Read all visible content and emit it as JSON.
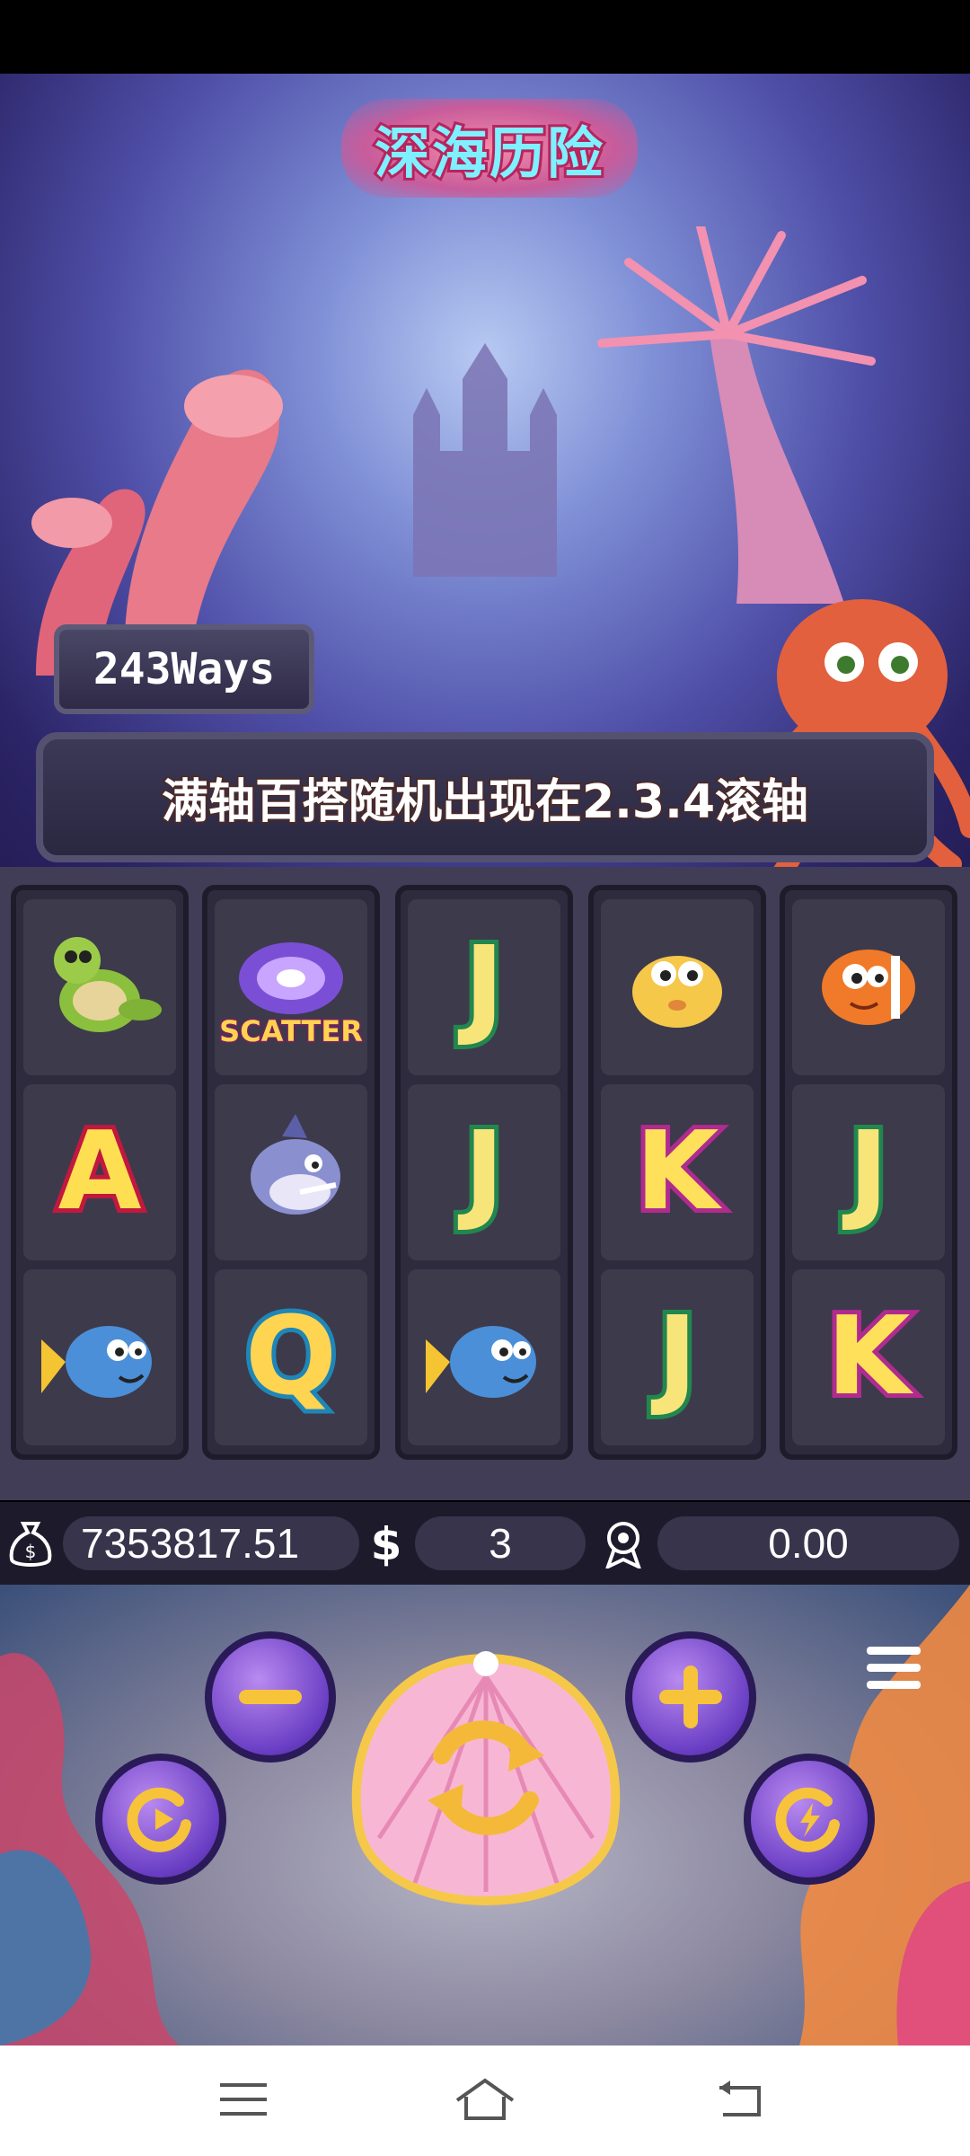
{
  "game": {
    "logo_title": "深海历险",
    "ways_label": "243Ways",
    "banner_text": "满轴百搭随机出现在2.3.4滚轴"
  },
  "reels": [
    [
      "turtle",
      "A",
      "fish"
    ],
    [
      "scatter",
      "shark",
      "Q"
    ],
    [
      "J",
      "J",
      "fish"
    ],
    [
      "pufferfish",
      "K",
      "J"
    ],
    [
      "clownfish",
      "J",
      "K"
    ]
  ],
  "symbols": {
    "scatter_label": "SCATTER",
    "A": "A",
    "K": "K",
    "Q": "Q",
    "J": "J"
  },
  "info_bar": {
    "balance_icon": "money-bag-icon",
    "balance": "7353817.51",
    "bet_icon": "dollar-icon",
    "bet": "3",
    "win_icon": "award-icon",
    "win": "0.00"
  },
  "controls": {
    "decrease_icon": "minus-icon",
    "increase_icon": "plus-icon",
    "spin_icon": "spin-arrows-icon",
    "autoplay_icon": "autoplay-icon",
    "turbo_icon": "turbo-icon",
    "menu_icon": "menu-icon"
  },
  "nav": {
    "menu_icon": "recent-apps-icon",
    "home_icon": "home-icon",
    "back_icon": "back-icon"
  },
  "colors": {
    "reel_frame": "#413d56",
    "button_purple": "#6a3ec4",
    "spin_gold": "#f5b93a",
    "shell_pink": "#f7b7d4"
  }
}
